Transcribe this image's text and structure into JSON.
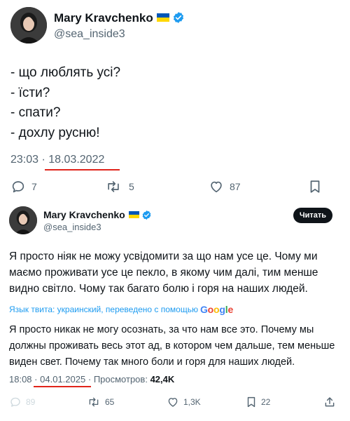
{
  "tweet1": {
    "author": {
      "name": "Mary Kravchenko",
      "handle": "@sea_inside3"
    },
    "lines": [
      "- що люблять усі?",
      "- їсти?",
      "- спати?",
      "- дохлу русню!"
    ],
    "time": "23:03",
    "separator": "·",
    "date": "18.03.2022",
    "actions": {
      "replies": "7",
      "retweets": "5",
      "likes": "87"
    }
  },
  "tweet2": {
    "author": {
      "name": "Mary Kravchenko",
      "handle": "@sea_inside3"
    },
    "read_button": "Читать",
    "text": "Я просто ніяк не можу усвідомити за що нам усе це. Чому ми маємо проживати усе це пекло, в якому чим далі, тим менше видно світло. Чому так багато болю і горя на наших людей.",
    "translation_note": "Язык твита: украинский, переведено с помощью",
    "google_logo": [
      "G",
      "o",
      "o",
      "g",
      "l",
      "e"
    ],
    "translation": "Я просто никак не могу осознать, за что нам все это. Почему мы должны проживать весь этот ад, в котором чем дальше, тем меньше виден свет. Почему так много боли и горя для наших людей.",
    "time": "18:08",
    "separator": "·",
    "date": "04.01.2025",
    "views_label": "Просмотров:",
    "views": "42,4K",
    "actions": {
      "replies": "89",
      "retweets": "65",
      "likes": "1,3K",
      "bookmarks": "22"
    }
  },
  "colors": {
    "flag_blue": "#0057b7",
    "flag_yellow": "#ffd700",
    "verified": "#1d9bf0",
    "underline": "#e0241b",
    "muted": "#536471"
  },
  "icons": [
    "verified-badge-icon",
    "reply-icon",
    "retweet-icon",
    "like-icon",
    "bookmark-icon",
    "share-icon"
  ]
}
